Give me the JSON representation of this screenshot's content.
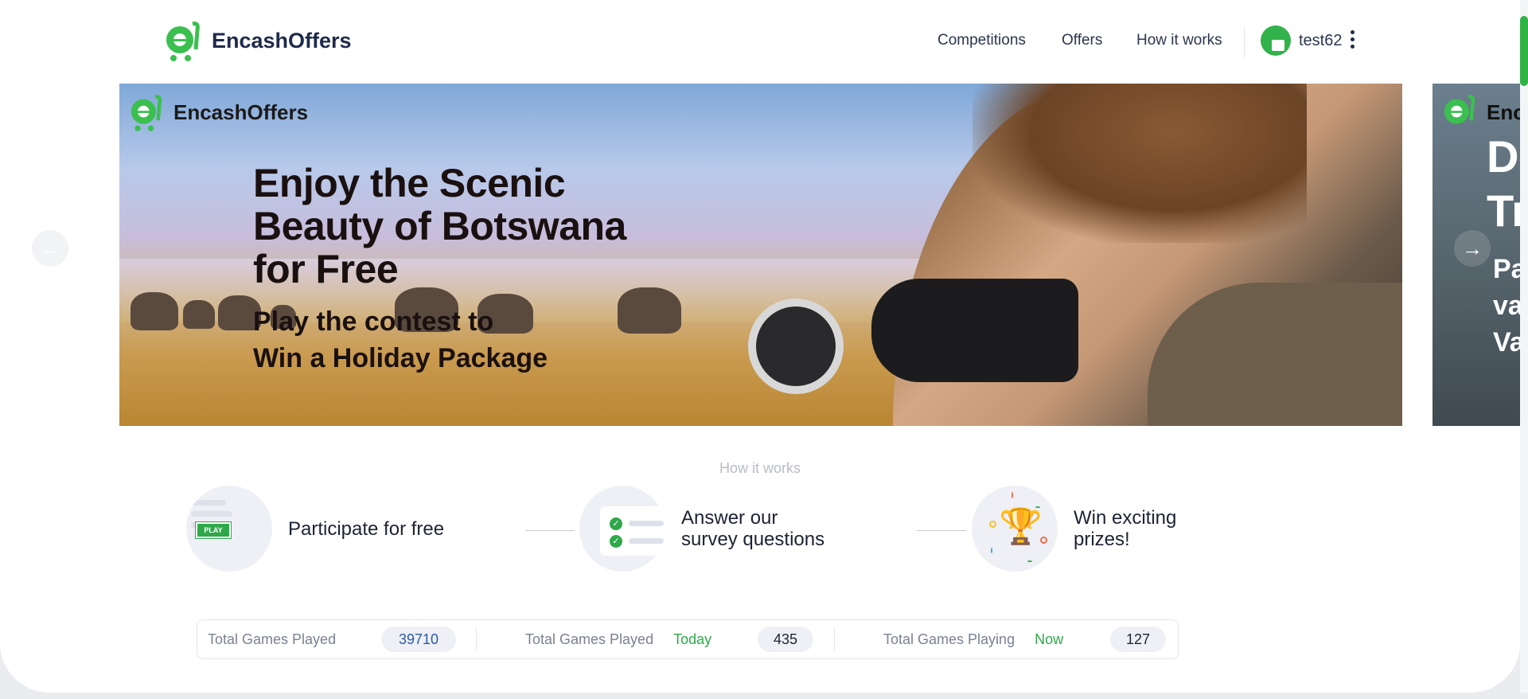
{
  "header": {
    "brand": "EncashOffers",
    "nav": [
      {
        "label": "Competitions"
      },
      {
        "label": "Offers"
      },
      {
        "label": "How it works"
      }
    ],
    "user": {
      "name": "test62"
    }
  },
  "carousel": {
    "slides": [
      {
        "brand": "EncashOffers",
        "headline": [
          "Enjoy the Scenic",
          "Beauty of Botswana",
          "for Free"
        ],
        "subline": [
          "Play the contest to",
          "Win a Holiday Package"
        ]
      },
      {
        "brand": "Enc",
        "headline": [
          "D",
          "Tr"
        ],
        "subline": [
          "Pa",
          "va",
          "Va"
        ]
      }
    ]
  },
  "how_it_works": {
    "title": "How it works",
    "steps": [
      {
        "label": [
          "Participate for free"
        ],
        "badge": "PLAY"
      },
      {
        "label": [
          "Answer our",
          "survey questions"
        ]
      },
      {
        "label": [
          "Win exciting",
          "prizes!"
        ]
      }
    ]
  },
  "stats": [
    {
      "label": "Total Games Played",
      "extra": "",
      "value": "39710",
      "value_color": "#2d5aa6"
    },
    {
      "label": "Total Games Played",
      "extra": "Today",
      "value": "435",
      "value_color": "#1e2233"
    },
    {
      "label": "Total Games Playing",
      "extra": "Now",
      "value": "127",
      "value_color": "#1e2233"
    }
  ],
  "colors": {
    "brand_green": "#32b24a",
    "text_dark": "#1e2a4a"
  }
}
